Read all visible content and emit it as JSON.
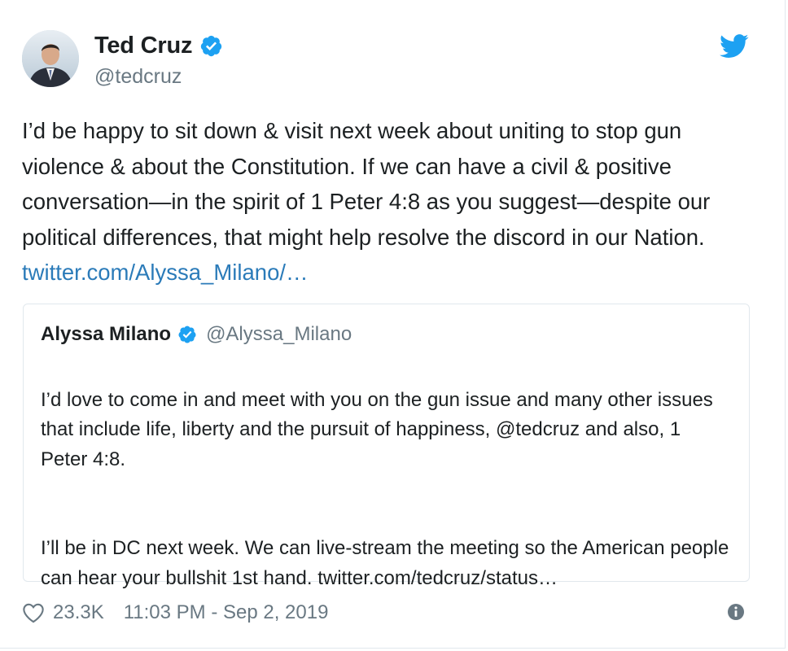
{
  "tweet": {
    "author": {
      "name": "Ted Cruz",
      "handle": "@tedcruz",
      "verified": true,
      "avatar_icon": "profile-photo"
    },
    "text": "I’d be happy to sit down & visit next week about uniting to stop gun violence & about the Constitution. If we can have a civil & positive conversation—in the spirit of 1 Peter 4:8 as you suggest—despite our political differences, that might help resolve the discord in our Nation. ",
    "link": "twitter.com/Alyssa_Milano/…",
    "likes": "23.3K",
    "timestamp": "11:03 PM - Sep 2, 2019",
    "brand_icon": "twitter-bird-icon",
    "colors": {
      "brand": "#1da1f2",
      "link": "#2b7bb9",
      "text": "#1c2022",
      "muted": "#697882",
      "border": "#e1e8ed"
    }
  },
  "quoted": {
    "name": "Alyssa Milano",
    "handle": "@Alyssa_Milano",
    "verified": true,
    "paragraph1": "I’d love to come in and meet with you on the gun issue and many other issues that include life, liberty and the pursuit of happiness, @tedcruz and also, 1 Peter 4:8.",
    "paragraph2": "I’ll be in DC next week. We can live-stream the meeting so the American people can hear your bullshit 1st hand. twitter.com/tedcruz/status…"
  }
}
